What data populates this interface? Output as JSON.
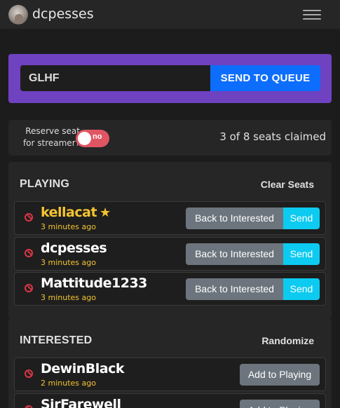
{
  "navbar": {
    "brand": "dcpesses"
  },
  "queue": {
    "input_value": "GLHF",
    "send_label": "SEND TO QUEUE"
  },
  "reserve": {
    "label_line1": "Reserve seat",
    "label_line2": "for streamer?",
    "toggle_text": "no",
    "seats_text": "3 of 8 seats claimed"
  },
  "playing": {
    "title": "PLAYING",
    "action": "Clear Seats",
    "rows": [
      {
        "name": "kellacat",
        "time": "3 minutes ago",
        "back_label": "Back to Interested",
        "send_label": "Send"
      },
      {
        "name": "dcpesses",
        "time": "3 minutes ago",
        "back_label": "Back to Interested",
        "send_label": "Send"
      },
      {
        "name": "Mattitude1233",
        "time": "3 minutes ago",
        "back_label": "Back to Interested",
        "send_label": "Send"
      }
    ]
  },
  "interested": {
    "title": "INTERESTED",
    "action": "Randomize",
    "rows": [
      {
        "name": "DewinBlack",
        "time": "2 minutes ago",
        "add_label": "Add to Playing"
      },
      {
        "name": "SirFarewell",
        "time": "",
        "add_label": "Add to Playing"
      }
    ]
  },
  "colors": {
    "accent_purple": "#6f42c1",
    "primary_blue": "#0d6efd",
    "info_cyan": "#0dcaf0",
    "danger_red": "#dc3545",
    "gold": "#f4c430",
    "secondary_gray": "#6c757d"
  },
  "icons": {
    "ban": "ban-icon",
    "star": "star-icon",
    "menu": "hamburger-menu-icon"
  }
}
